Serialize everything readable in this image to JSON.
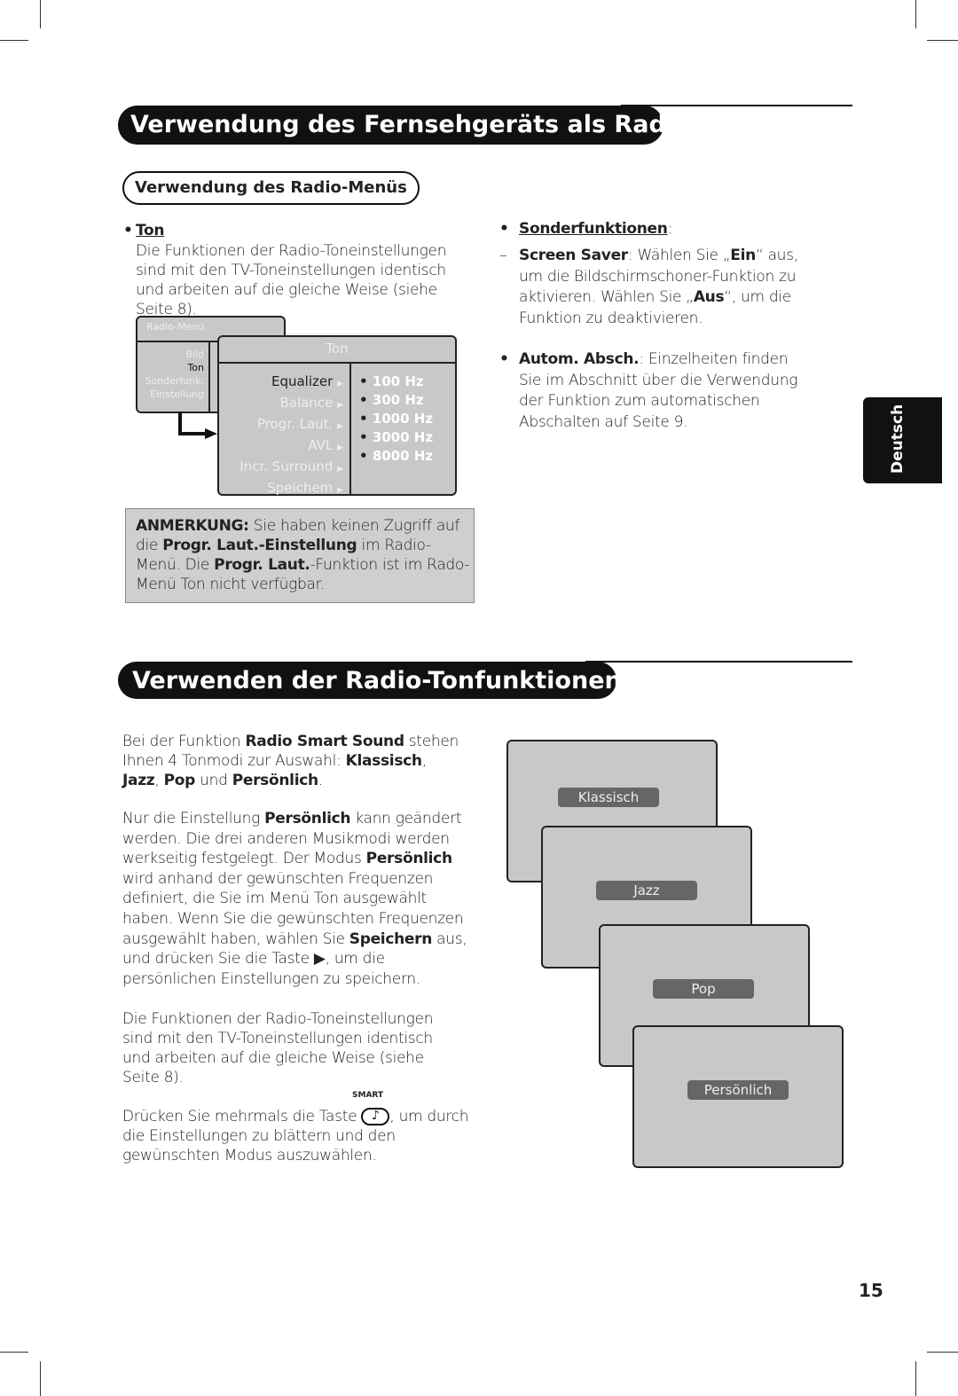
{
  "section1": {
    "title": "Verwendung des Fernsehgeräts als Radio",
    "subtitle": "Verwendung des Radio-Menüs",
    "ton": {
      "heading": "Ton",
      "text": [
        [
          "Die Funktionen der Radio-Toneinstellungen sind mit den TV-Toneinstellungen identisch und arbeiten auf die gleiche Weise (siehe Seite 8).",
          ""
        ]
      ]
    },
    "menu": {
      "title": "Radio-Menü",
      "items": [
        "Bild",
        "Ton",
        "Sonderfunk.",
        "Einstellung"
      ],
      "submenu_title": "Ton",
      "subitems": [
        "Equalizer",
        "Balance",
        "Progr. Laut.",
        "AVL",
        "Incr. Surround",
        "Speichem"
      ],
      "frequencies": [
        "100 Hz",
        "300 Hz",
        "1000 Hz",
        "3000 Hz",
        "8000 Hz"
      ]
    },
    "note": [
      [
        "ANMERKUNG:",
        "b"
      ],
      [
        " Sie haben keinen Zugriff auf die ",
        ""
      ],
      [
        "Progr. Laut.-Einstellung",
        "b"
      ],
      [
        " im Radio-Menü. Die ",
        ""
      ],
      [
        "Progr. Laut.",
        "b"
      ],
      [
        "-Funktion ist im Rado-Menü Ton nicht verfügbar.",
        ""
      ]
    ],
    "sonder": {
      "heading": "Sonderfunktionen",
      "screensaver": [
        [
          "Screen Saver",
          "b"
        ],
        [
          ": Wählen Sie „",
          ""
        ],
        [
          "Ein",
          "b"
        ],
        [
          "“ aus, um die Bildschirmschoner-Funktion zu aktivieren. Wählen Sie „",
          ""
        ],
        [
          "Aus",
          "b"
        ],
        [
          "“, um die Funktion zu deaktivieren.",
          ""
        ]
      ],
      "autom": [
        [
          "Autom. Absch.",
          "b"
        ],
        [
          ": Einzelheiten finden Sie im Abschnitt über die Verwendung der Funktion zum automatischen Abschalten auf Seite 9.",
          ""
        ]
      ]
    }
  },
  "side_tab": "Deutsch",
  "section2": {
    "title": "Verwenden der Radio-Tonfunktionen",
    "p1": [
      [
        "Bei der Funktion ",
        ""
      ],
      [
        "Radio Smart Sound",
        "b"
      ],
      [
        " stehen Ihnen 4 Tonmodi zur Auswahl: ",
        ""
      ],
      [
        "Klassisch",
        "b"
      ],
      [
        ", ",
        ""
      ],
      [
        "Jazz",
        "b"
      ],
      [
        ", ",
        ""
      ],
      [
        "Pop",
        "b"
      ],
      [
        " und ",
        ""
      ],
      [
        "Persönlich",
        "b"
      ],
      [
        ".",
        ""
      ]
    ],
    "p2": [
      [
        "Nur die Einstellung ",
        ""
      ],
      [
        "Persönlich",
        "b"
      ],
      [
        " kann geändert werden. Die drei anderen Musikmodi werden werkseitig festgelegt. Der Modus ",
        ""
      ],
      [
        "Persönlich",
        "b"
      ],
      [
        " wird anhand der gewünschten Frequenzen definiert, die Sie im Menü Ton ausgewählt haben. Wenn Sie die gewünschten Frequenzen ausgewählt haben, wählen Sie ",
        ""
      ],
      [
        "Speichern",
        "b"
      ],
      [
        " aus, und drücken Sie die Taste ▶, um die persönlichen Einstellungen zu speichern.",
        ""
      ]
    ],
    "p3": [
      [
        "Die Funktionen der Radio-Toneinstellungen sind mit den TV-Toneinstellungen identisch und arbeiten auf die gleiche Weise (siehe Seite 8).",
        ""
      ]
    ],
    "p4a": "Drücken Sie mehrmals die Taste",
    "p4b": ", um durch die Einstellungen zu blättern und den gewünschten Modus auszuwählen.",
    "smart_label": "SMART",
    "smart_icon": "music-note-button-icon",
    "modes": [
      "Klassisch",
      "Jazz",
      "Pop",
      "Persönlich"
    ]
  },
  "page_number": "15"
}
